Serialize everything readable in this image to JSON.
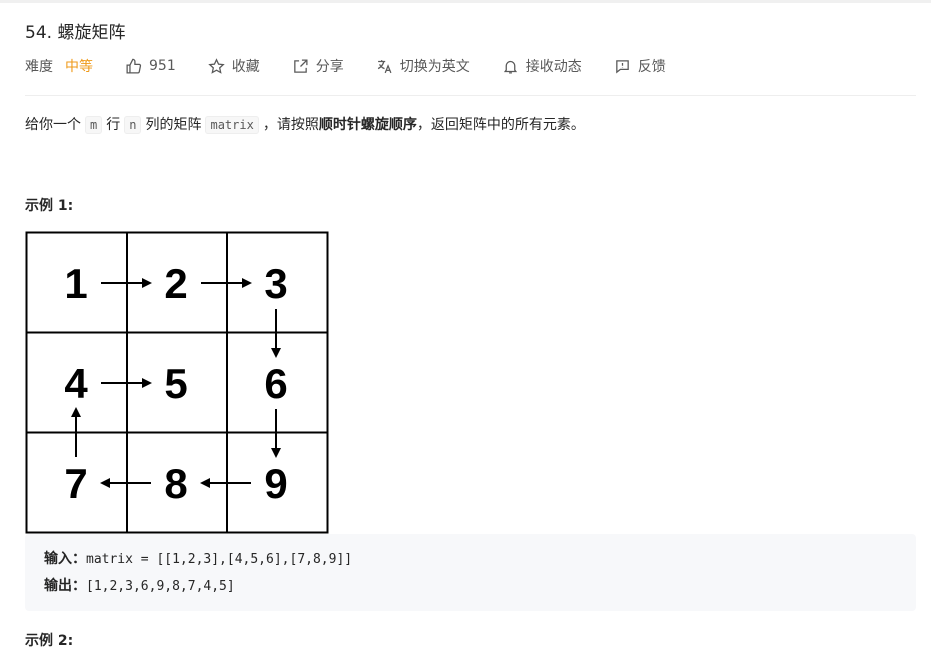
{
  "problem": {
    "title": "54. 螺旋矩阵",
    "difficulty_label": "难度",
    "difficulty_value": "中等",
    "likes": "951",
    "actions": {
      "favorite": "收藏",
      "share": "分享",
      "switch_lang": "切换为英文",
      "subscribe": "接收动态",
      "feedback": "反馈"
    },
    "description": {
      "p1": "给你一个",
      "m": "m",
      "p2": "行",
      "n": "n",
      "p3": "列的矩阵",
      "matrix": "matrix",
      "p4": "，请按照",
      "bold": "顺时针螺旋顺序",
      "p5": "，返回矩阵中的所有元素。"
    },
    "example1": {
      "title": "示例 1:",
      "grid": [
        "1",
        "2",
        "3",
        "4",
        "5",
        "6",
        "7",
        "8",
        "9"
      ],
      "input_label": "输入：",
      "input_value": "matrix = [[1,2,3],[4,5,6],[7,8,9]]",
      "output_label": "输出：",
      "output_value": "[1,2,3,6,9,8,7,4,5]"
    },
    "example2": {
      "title": "示例 2:"
    }
  },
  "colors": {
    "difficulty_medium": "#ef9a1a",
    "text": "#262626",
    "muted": "#595959"
  },
  "icons": [
    "thumbs-up-icon",
    "star-icon",
    "share-icon",
    "translate-icon",
    "bell-icon",
    "feedback-icon"
  ]
}
